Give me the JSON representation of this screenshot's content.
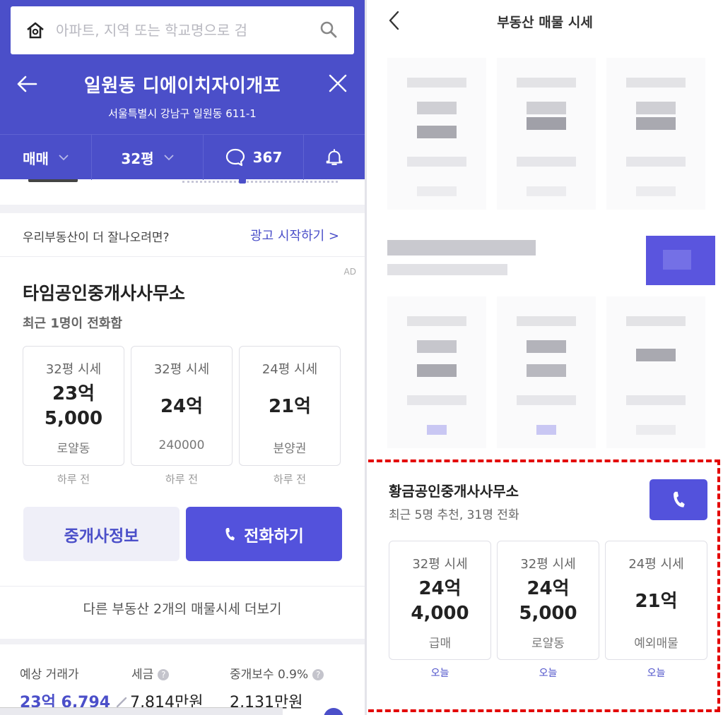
{
  "left": {
    "search": {
      "placeholder": "아파트, 지역 또는 학교명으로 검"
    },
    "title": "일원동 디에이치자이개포",
    "address": "서울특별시 강남구 일원동 611-1",
    "tabs": {
      "deal": "매매",
      "size": "32평",
      "comments": "367"
    },
    "ad_prompt": "우리부동산이 더 잘나오려면?",
    "ad_start": "광고 시작하기 >",
    "ad_tag": "AD",
    "office": {
      "name": "타임공인중개사사무소",
      "recent": "최근 1명이 전화함",
      "cards": [
        {
          "label": "32평 시세",
          "price": [
            "23억",
            "5,000"
          ],
          "note": "로얄동",
          "ago": "하루 전"
        },
        {
          "label": "32평 시세",
          "price": [
            "24억"
          ],
          "note": "240000",
          "ago": "하루 전"
        },
        {
          "label": "24평 시세",
          "price": [
            "21억"
          ],
          "note": "분양권",
          "ago": "하루 전"
        }
      ],
      "info_button": "중개사정보",
      "call_button": "전화하기"
    },
    "more_link": "다른 부동산 2개의 매물시세 더보기",
    "estimate": {
      "price_label": "예상 거래가",
      "price_value": "23억 6,794",
      "tax_label": "세금",
      "tax_value": "7,814만원",
      "fee_label": "중개보수 0.9%",
      "fee_value": "2,131만원"
    }
  },
  "right": {
    "title": "부동산 매물 시세",
    "highlight": {
      "name": "황금공인중개사사무소",
      "sub": "최근 5명 추천, 31명 전화",
      "cards": [
        {
          "label": "32평 시세",
          "price": [
            "24억",
            "4,000"
          ],
          "note": "급매",
          "ago": "오늘"
        },
        {
          "label": "32평 시세",
          "price": [
            "24억",
            "5,000"
          ],
          "note": "로얄동",
          "ago": "오늘"
        },
        {
          "label": "24평 시세",
          "price": [
            "21억"
          ],
          "note": "예외매물",
          "ago": "오늘"
        }
      ]
    }
  },
  "colors": {
    "brand": "#4b4fc9",
    "button": "#5352dc",
    "highlight_border": "#e30000"
  }
}
